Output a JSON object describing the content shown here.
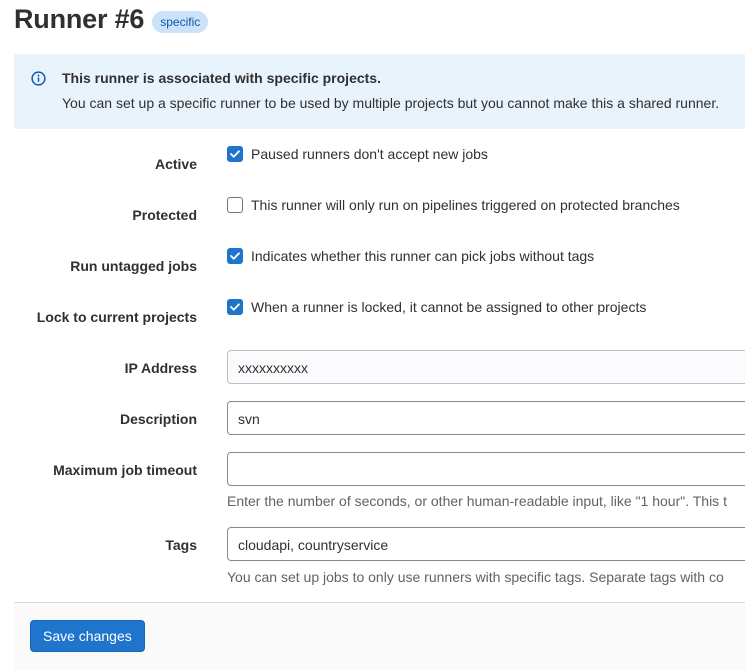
{
  "header": {
    "title": "Runner #6",
    "badge": "specific"
  },
  "alert": {
    "icon": "info-icon",
    "title": "This runner is associated with specific projects.",
    "body": "You can set up a specific runner to be used by multiple projects but you cannot make this a shared runner."
  },
  "form": {
    "active": {
      "label": "Active",
      "checked": true,
      "text": "Paused runners don't accept new jobs"
    },
    "protected": {
      "label": "Protected",
      "checked": false,
      "text": "This runner will only run on pipelines triggered on protected branches"
    },
    "run_untagged": {
      "label": "Run untagged jobs",
      "checked": true,
      "text": "Indicates whether this runner can pick jobs without tags"
    },
    "locked": {
      "label": "Lock to current projects",
      "checked": true,
      "text": "When a runner is locked, it cannot be assigned to other projects"
    },
    "ip_address": {
      "label": "IP Address",
      "value": "xxxxxxxxxx"
    },
    "description": {
      "label": "Description",
      "value": "svn"
    },
    "max_timeout": {
      "label": "Maximum job timeout",
      "value": "",
      "help": "Enter the number of seconds, or other human-readable input, like \"1 hour\". This t"
    },
    "tags": {
      "label": "Tags",
      "value": "cloudapi, countryservice",
      "help": "You can set up jobs to only use runners with specific tags. Separate tags with co"
    }
  },
  "footer": {
    "save_label": "Save changes"
  },
  "colors": {
    "primary": "#1f75cb",
    "badge_bg": "#cbe2f9",
    "alert_bg": "#e9f3fc"
  }
}
